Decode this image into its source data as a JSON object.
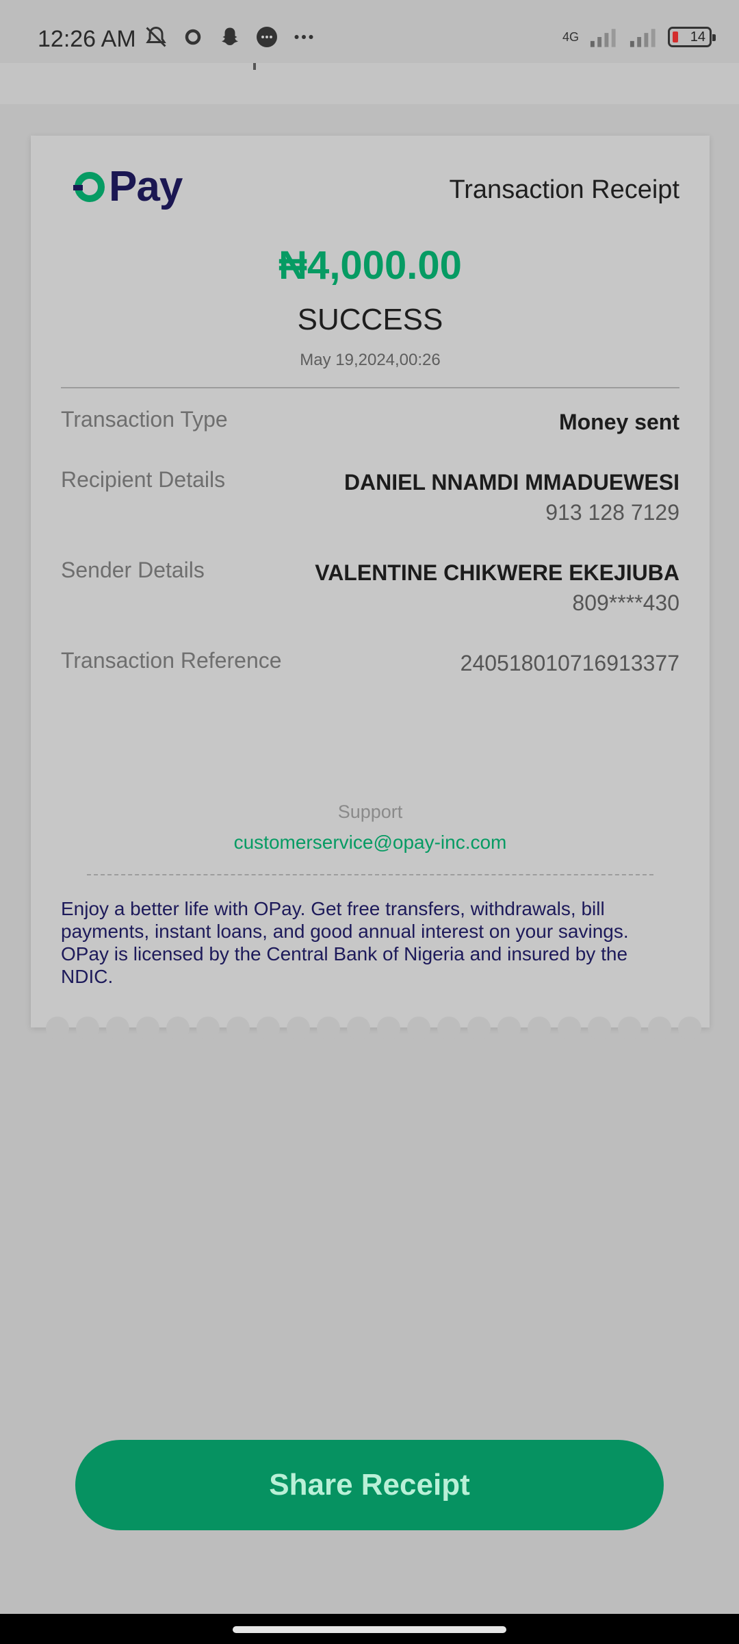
{
  "status_bar": {
    "time": "12:26 AM",
    "network": "4G",
    "battery": "14",
    "icons_left": [
      "bell-muted-icon",
      "sync-icon",
      "snapchat-icon",
      "messages-icon",
      "more-dots-icon"
    ],
    "icons_right": [
      "signal-icon",
      "signal-icon",
      "battery-icon"
    ]
  },
  "receipt": {
    "logo_text": "Pay",
    "title": "Transaction Receipt",
    "amount": "₦4,000.00",
    "status": "SUCCESS",
    "datetime": "May 19,2024,00:26",
    "rows": [
      {
        "label": "Transaction Type",
        "value": "Money sent",
        "sub": ""
      },
      {
        "label": "Recipient Details",
        "value": "DANIEL NNAMDI MMADUEWESI",
        "sub": "913 128 7129"
      },
      {
        "label": "Sender Details",
        "value": "VALENTINE CHIKWERE EKEJIUBA",
        "sub": "809****430"
      },
      {
        "label": "Transaction Reference",
        "value": "240518010716913377",
        "sub": ""
      }
    ],
    "support_label": "Support",
    "support_email": "customerservice@opay-inc.com",
    "promo": "Enjoy a better life with OPay. Get free transfers, withdrawals, bill payments, instant loans, and good annual interest on your savings. OPay is licensed by the Central Bank of Nigeria and insured by the NDIC."
  },
  "actions": {
    "share_label": "Share Receipt"
  },
  "colors": {
    "brand_green": "#069b63",
    "brand_navy": "#1b1752",
    "background": "#bdbdbd"
  }
}
